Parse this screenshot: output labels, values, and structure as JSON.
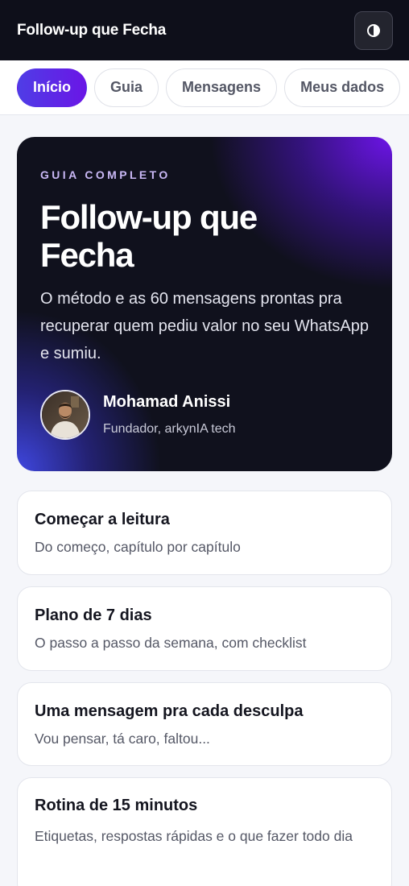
{
  "header": {
    "title": "Follow-up que Fecha",
    "theme_icon": "contrast-icon"
  },
  "tabs": [
    {
      "label": "Início",
      "active": true
    },
    {
      "label": "Guia",
      "active": false
    },
    {
      "label": "Mensagens",
      "active": false
    },
    {
      "label": "Meus dados",
      "active": false
    }
  ],
  "hero": {
    "eyebrow": "GUIA COMPLETO",
    "title": "Follow-up que Fecha",
    "description": "O método e as 60 mensagens prontas pra recuperar quem pediu valor no seu WhatsApp e sumiu.",
    "author": {
      "name": "Mohamad Anissi",
      "role": "Fundador, arkynIA tech"
    }
  },
  "cards": [
    {
      "title": "Começar a leitura",
      "subtitle": "Do começo, capítulo por capítulo"
    },
    {
      "title": "Plano de 7 dias",
      "subtitle": "O passo a passo da semana, com checklist"
    },
    {
      "title": "Uma mensagem pra cada desculpa",
      "subtitle": "Vou pensar, tá caro, faltou..."
    },
    {
      "title": "Rotina de 15 minutos",
      "subtitle": "Etiquetas, respostas rápidas e o que fazer todo dia"
    }
  ],
  "colors": {
    "topbar": "#0e0f1a",
    "accent_start": "#4f3de6",
    "accent_end": "#6a16e6",
    "hero_bg": "#10111d"
  }
}
